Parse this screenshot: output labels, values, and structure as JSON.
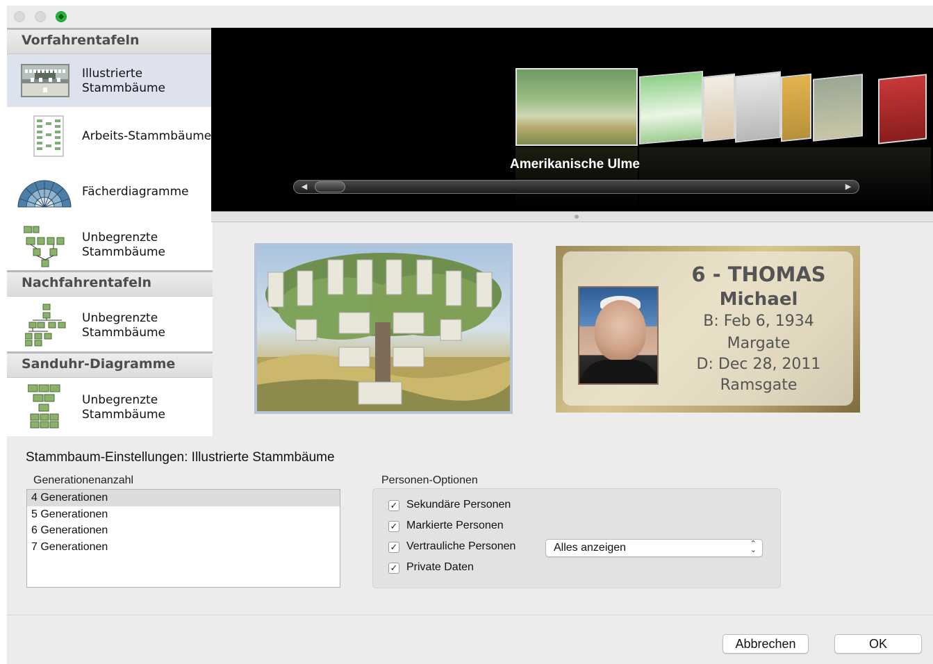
{
  "sidebar": {
    "sections": [
      {
        "header": "Vorfahrentafeln",
        "items": [
          {
            "label": "Illustrierte\nStammbäume",
            "icon": "illustrated-tree-icon",
            "selected": true
          },
          {
            "label": "Arbeits-Stammbäume",
            "icon": "working-tree-icon"
          },
          {
            "label": "Fächerdiagramme",
            "icon": "fan-chart-icon"
          },
          {
            "label": "Unbegrenzte\nStammbäume",
            "icon": "unlimited-tree-icon"
          }
        ]
      },
      {
        "header": "Nachfahrentafeln",
        "items": [
          {
            "label": "Unbegrenzte\nStammbäume",
            "icon": "descendant-tree-icon"
          }
        ]
      },
      {
        "header": "Sanduhr-Diagramme",
        "items": [
          {
            "label": "Unbegrenzte\nStammbäume",
            "icon": "hourglass-tree-icon"
          }
        ]
      }
    ]
  },
  "coverflow": {
    "caption": "Amerikanische Ulme",
    "colors": {
      "background": "#000000",
      "caption": "#ffffff"
    }
  },
  "preview": {
    "detail": {
      "line1": "6 - THOMAS",
      "line2": "Michael",
      "line3": "B: Feb 6, 1934",
      "line4": "Margate",
      "line5": "D: Dec 28, 2011",
      "line6": "Ramsgate"
    }
  },
  "settings": {
    "title": "Stammbaum-Einstellungen: Illustrierte Stammbäume",
    "generations": {
      "label": "Generationenanzahl",
      "options": [
        "4 Generationen",
        "5 Generationen",
        "6 Generationen",
        "7 Generationen"
      ],
      "selected": "4 Generationen"
    },
    "person_options": {
      "label": "Personen-Optionen",
      "checkboxes": [
        {
          "label": "Sekundäre Personen",
          "checked": true
        },
        {
          "label": "Markierte Personen",
          "checked": true
        },
        {
          "label": "Vertrauliche Personen",
          "checked": true
        },
        {
          "label": "Private Daten",
          "checked": true
        }
      ],
      "select_value": "Alles anzeigen"
    }
  },
  "buttons": {
    "cancel": "Abbrechen",
    "ok": "OK"
  },
  "colors": {
    "selection": "#dde2ee",
    "zoom_button": "#27b43c"
  }
}
